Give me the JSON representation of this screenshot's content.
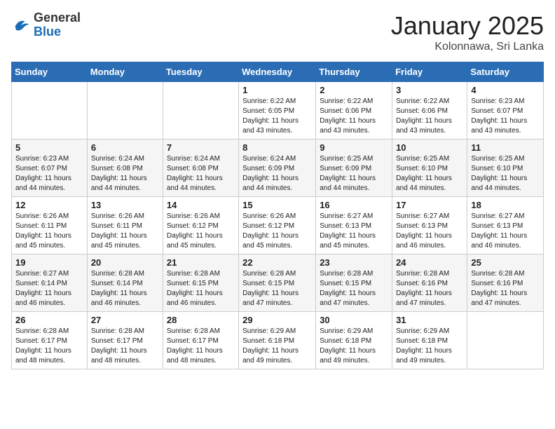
{
  "header": {
    "logo_general": "General",
    "logo_blue": "Blue",
    "title": "January 2025",
    "location": "Kolonnawa, Sri Lanka"
  },
  "weekdays": [
    "Sunday",
    "Monday",
    "Tuesday",
    "Wednesday",
    "Thursday",
    "Friday",
    "Saturday"
  ],
  "weeks": [
    [
      {
        "day": "",
        "info": ""
      },
      {
        "day": "",
        "info": ""
      },
      {
        "day": "",
        "info": ""
      },
      {
        "day": "1",
        "info": "Sunrise: 6:22 AM\nSunset: 6:05 PM\nDaylight: 11 hours and 43 minutes."
      },
      {
        "day": "2",
        "info": "Sunrise: 6:22 AM\nSunset: 6:06 PM\nDaylight: 11 hours and 43 minutes."
      },
      {
        "day": "3",
        "info": "Sunrise: 6:22 AM\nSunset: 6:06 PM\nDaylight: 11 hours and 43 minutes."
      },
      {
        "day": "4",
        "info": "Sunrise: 6:23 AM\nSunset: 6:07 PM\nDaylight: 11 hours and 43 minutes."
      }
    ],
    [
      {
        "day": "5",
        "info": "Sunrise: 6:23 AM\nSunset: 6:07 PM\nDaylight: 11 hours and 44 minutes."
      },
      {
        "day": "6",
        "info": "Sunrise: 6:24 AM\nSunset: 6:08 PM\nDaylight: 11 hours and 44 minutes."
      },
      {
        "day": "7",
        "info": "Sunrise: 6:24 AM\nSunset: 6:08 PM\nDaylight: 11 hours and 44 minutes."
      },
      {
        "day": "8",
        "info": "Sunrise: 6:24 AM\nSunset: 6:09 PM\nDaylight: 11 hours and 44 minutes."
      },
      {
        "day": "9",
        "info": "Sunrise: 6:25 AM\nSunset: 6:09 PM\nDaylight: 11 hours and 44 minutes."
      },
      {
        "day": "10",
        "info": "Sunrise: 6:25 AM\nSunset: 6:10 PM\nDaylight: 11 hours and 44 minutes."
      },
      {
        "day": "11",
        "info": "Sunrise: 6:25 AM\nSunset: 6:10 PM\nDaylight: 11 hours and 44 minutes."
      }
    ],
    [
      {
        "day": "12",
        "info": "Sunrise: 6:26 AM\nSunset: 6:11 PM\nDaylight: 11 hours and 45 minutes."
      },
      {
        "day": "13",
        "info": "Sunrise: 6:26 AM\nSunset: 6:11 PM\nDaylight: 11 hours and 45 minutes."
      },
      {
        "day": "14",
        "info": "Sunrise: 6:26 AM\nSunset: 6:12 PM\nDaylight: 11 hours and 45 minutes."
      },
      {
        "day": "15",
        "info": "Sunrise: 6:26 AM\nSunset: 6:12 PM\nDaylight: 11 hours and 45 minutes."
      },
      {
        "day": "16",
        "info": "Sunrise: 6:27 AM\nSunset: 6:13 PM\nDaylight: 11 hours and 45 minutes."
      },
      {
        "day": "17",
        "info": "Sunrise: 6:27 AM\nSunset: 6:13 PM\nDaylight: 11 hours and 46 minutes."
      },
      {
        "day": "18",
        "info": "Sunrise: 6:27 AM\nSunset: 6:13 PM\nDaylight: 11 hours and 46 minutes."
      }
    ],
    [
      {
        "day": "19",
        "info": "Sunrise: 6:27 AM\nSunset: 6:14 PM\nDaylight: 11 hours and 46 minutes."
      },
      {
        "day": "20",
        "info": "Sunrise: 6:28 AM\nSunset: 6:14 PM\nDaylight: 11 hours and 46 minutes."
      },
      {
        "day": "21",
        "info": "Sunrise: 6:28 AM\nSunset: 6:15 PM\nDaylight: 11 hours and 46 minutes."
      },
      {
        "day": "22",
        "info": "Sunrise: 6:28 AM\nSunset: 6:15 PM\nDaylight: 11 hours and 47 minutes."
      },
      {
        "day": "23",
        "info": "Sunrise: 6:28 AM\nSunset: 6:15 PM\nDaylight: 11 hours and 47 minutes."
      },
      {
        "day": "24",
        "info": "Sunrise: 6:28 AM\nSunset: 6:16 PM\nDaylight: 11 hours and 47 minutes."
      },
      {
        "day": "25",
        "info": "Sunrise: 6:28 AM\nSunset: 6:16 PM\nDaylight: 11 hours and 47 minutes."
      }
    ],
    [
      {
        "day": "26",
        "info": "Sunrise: 6:28 AM\nSunset: 6:17 PM\nDaylight: 11 hours and 48 minutes."
      },
      {
        "day": "27",
        "info": "Sunrise: 6:28 AM\nSunset: 6:17 PM\nDaylight: 11 hours and 48 minutes."
      },
      {
        "day": "28",
        "info": "Sunrise: 6:28 AM\nSunset: 6:17 PM\nDaylight: 11 hours and 48 minutes."
      },
      {
        "day": "29",
        "info": "Sunrise: 6:29 AM\nSunset: 6:18 PM\nDaylight: 11 hours and 49 minutes."
      },
      {
        "day": "30",
        "info": "Sunrise: 6:29 AM\nSunset: 6:18 PM\nDaylight: 11 hours and 49 minutes."
      },
      {
        "day": "31",
        "info": "Sunrise: 6:29 AM\nSunset: 6:18 PM\nDaylight: 11 hours and 49 minutes."
      },
      {
        "day": "",
        "info": ""
      }
    ]
  ]
}
